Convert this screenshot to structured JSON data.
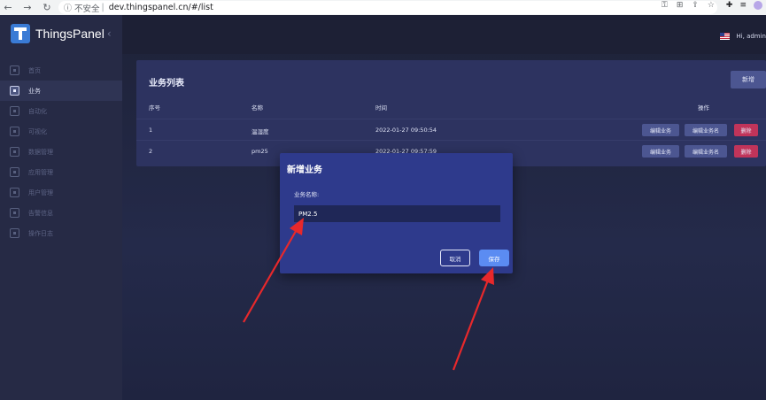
{
  "browser": {
    "back_icon": "←",
    "forward_icon": "→",
    "reload_icon": "↻",
    "info_icon": "ⓘ",
    "security_text": "不安全",
    "url": "dev.thingspanel.cn/#/list",
    "tool_icons": [
      "key-icon",
      "translate-icon",
      "share-icon",
      "star-icon"
    ],
    "extension_icons": [
      "puzzle-icon",
      "reading-list-icon",
      "profile-icon"
    ]
  },
  "sidebar": {
    "brand": "ThingsPanel",
    "collapse_icon": "‹",
    "items": [
      {
        "label": "首页",
        "icon": "home-icon"
      },
      {
        "label": "业务",
        "icon": "business-icon",
        "active": true
      },
      {
        "label": "自动化",
        "icon": "automation-icon"
      },
      {
        "label": "可视化",
        "icon": "visualization-icon"
      },
      {
        "label": "数据管理",
        "icon": "data-icon"
      },
      {
        "label": "应用管理",
        "icon": "app-icon"
      },
      {
        "label": "用户管理",
        "icon": "user-icon"
      },
      {
        "label": "告警信息",
        "icon": "alarm-icon"
      },
      {
        "label": "操作日志",
        "icon": "log-icon"
      }
    ]
  },
  "header": {
    "user_greeting": "Hi, admin"
  },
  "list": {
    "title": "业务列表",
    "add_label": "新增",
    "columns": {
      "index": "序号",
      "name": "名称",
      "time": "时间",
      "actions": "操作"
    },
    "rows": [
      {
        "index": "1",
        "name": "温湿度",
        "time": "2022-01-27 09:50:54",
        "edit": "编辑业务",
        "edit_name": "编辑业务名",
        "delete": "删除"
      },
      {
        "index": "2",
        "name": "pm25",
        "time": "2022-01-27 09:57:59",
        "edit": "编辑业务",
        "edit_name": "编辑业务名",
        "delete": "删除"
      }
    ]
  },
  "modal": {
    "title": "新增业务",
    "field_label": "业务名称:",
    "field_value": "PM2.5",
    "cancel_label": "取消",
    "save_label": "保存"
  },
  "colors": {
    "sidebar_bg": "#262a45",
    "card_bg": "#2d3360",
    "modal_bg": "#2e3a8c",
    "primary": "#5b8cf2",
    "danger": "#c0345a",
    "annotation_arrow": "#e8282b"
  }
}
